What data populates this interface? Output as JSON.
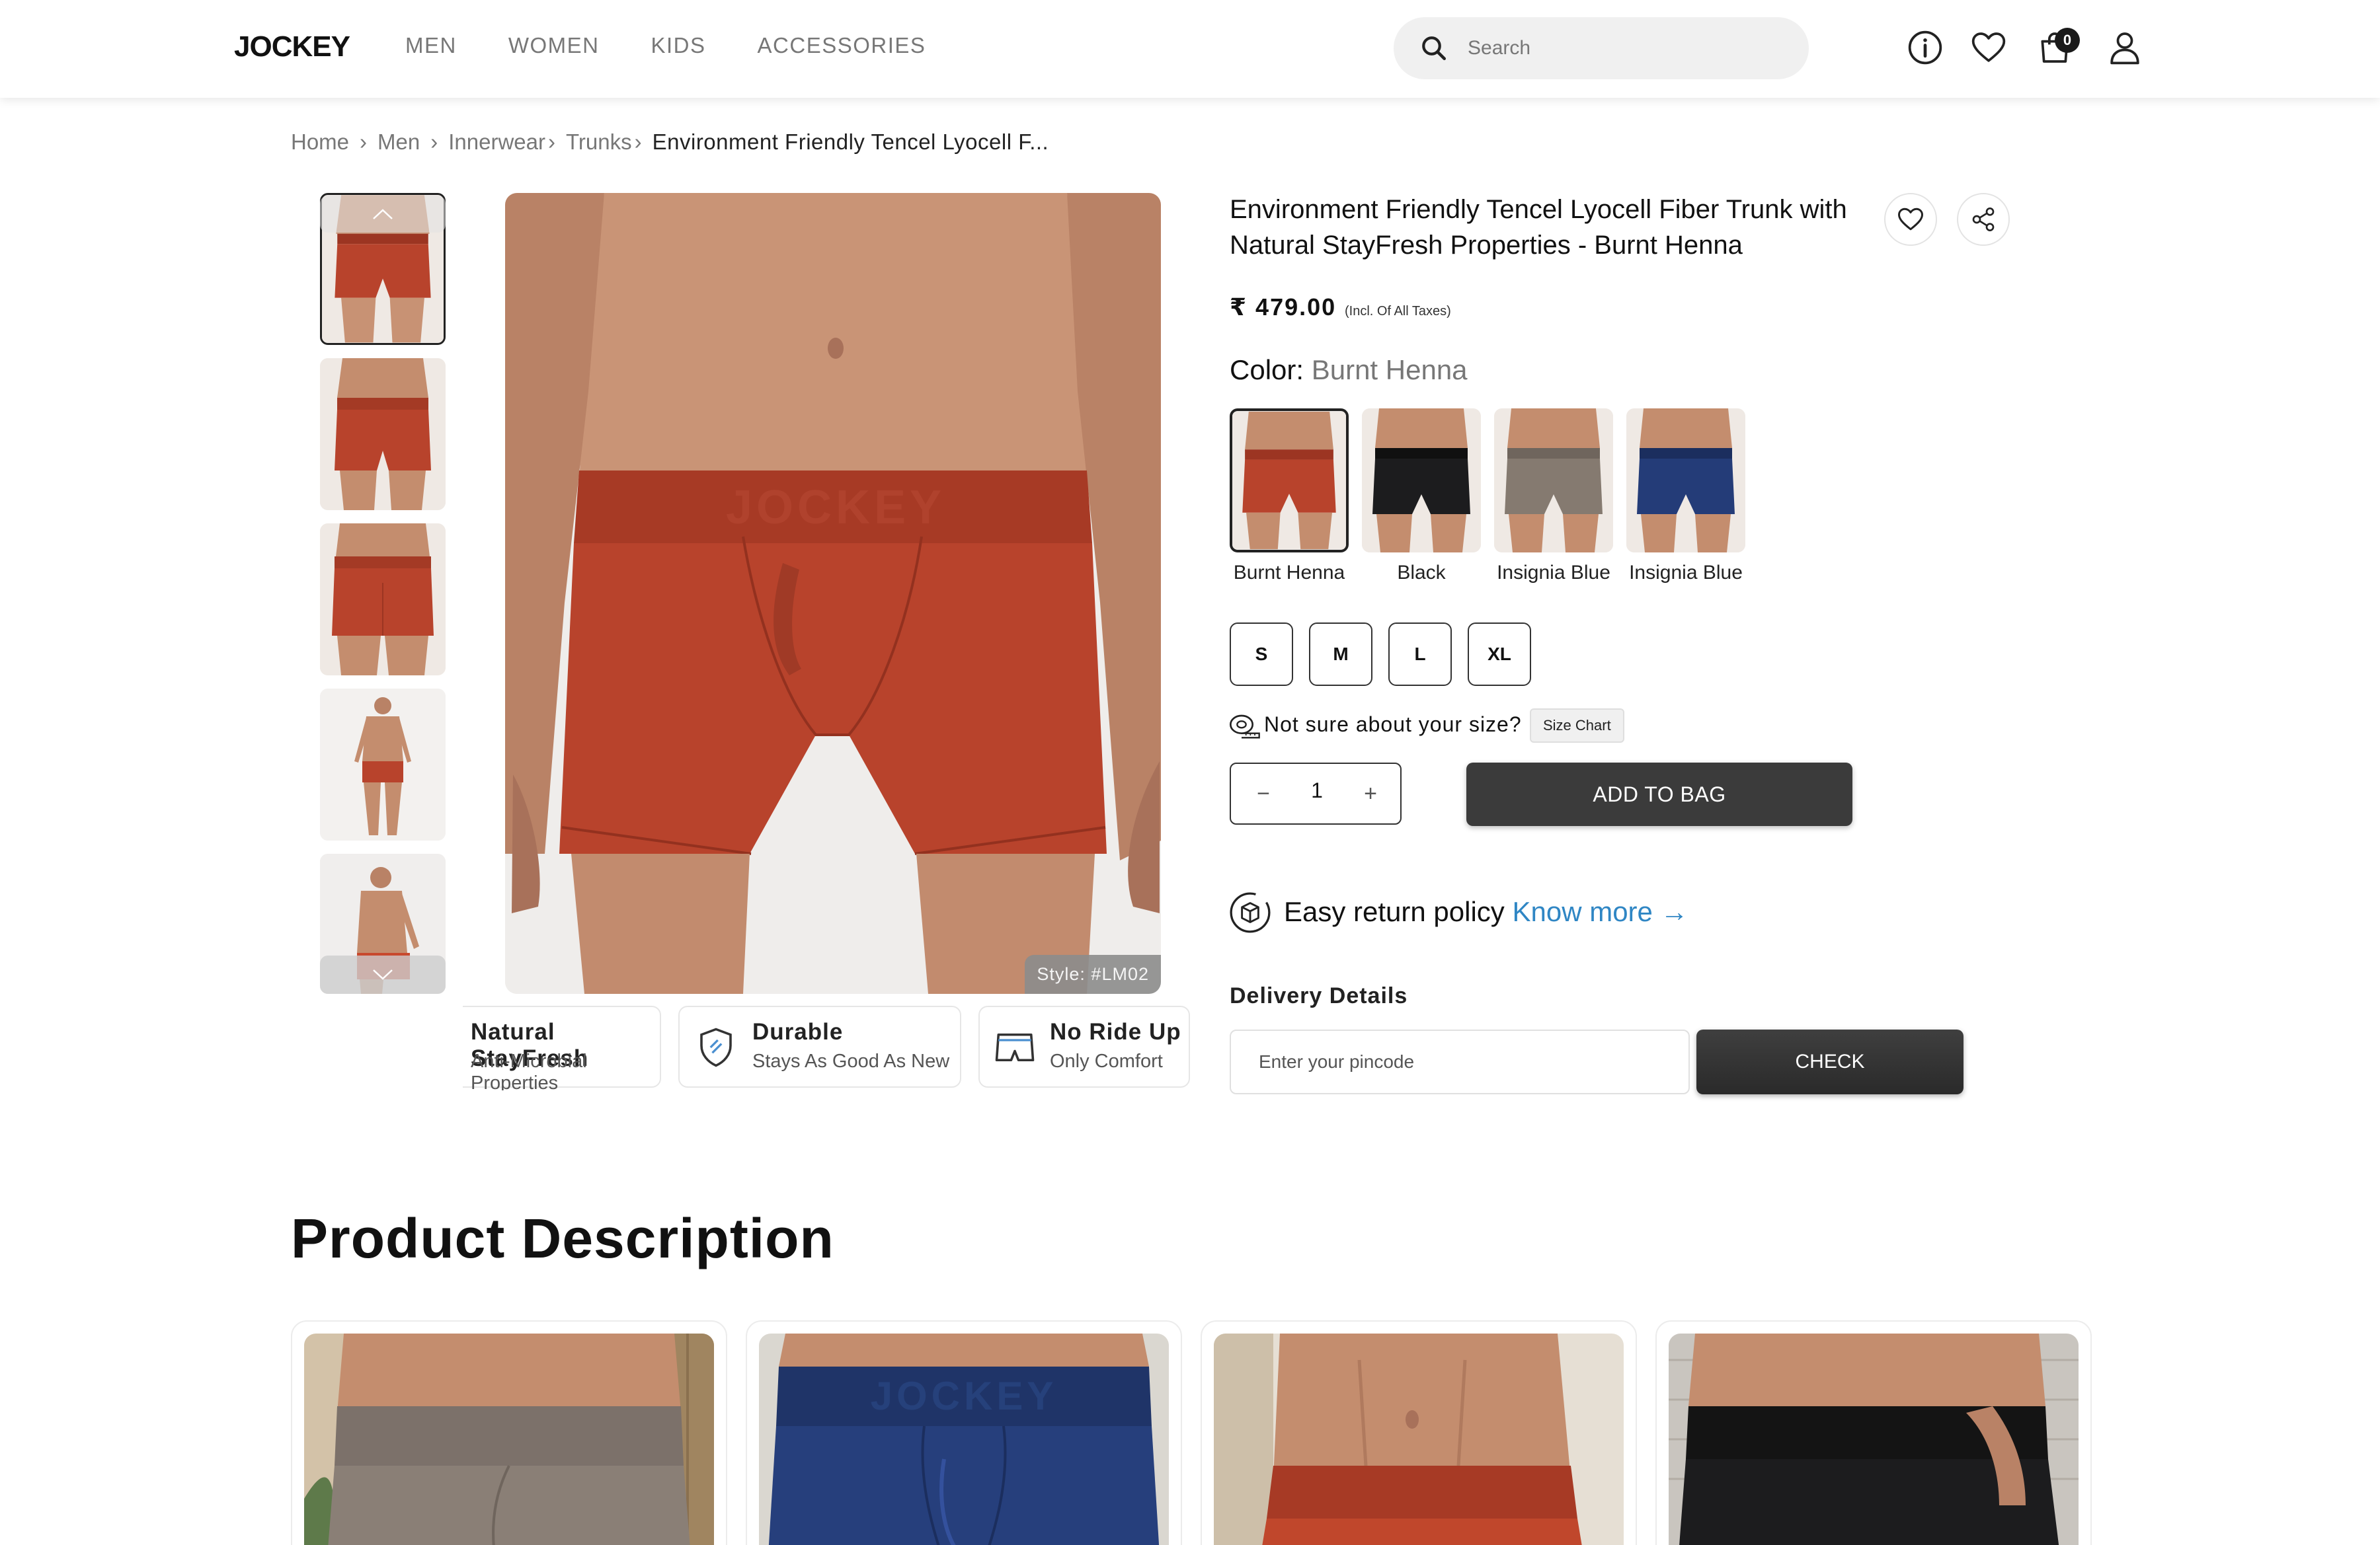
{
  "header": {
    "logo": "JOCKEY",
    "nav": [
      "MEN",
      "WOMEN",
      "KIDS",
      "ACCESSORIES"
    ],
    "search_placeholder": "Search",
    "cart_count": "0"
  },
  "breadcrumb": {
    "items": [
      "Home",
      "Men",
      "Innerwear",
      "Trunks"
    ],
    "separator": "›",
    "current": "Environment Friendly Tencel Lyocell F..."
  },
  "gallery": {
    "style_badge": "Style: #LM02"
  },
  "features": [
    {
      "title": "Natural StayFresh",
      "subtitle": "Anti-Microbial Properties"
    },
    {
      "title": "Durable",
      "subtitle": "Stays As Good As New"
    },
    {
      "title": "No Ride Up",
      "subtitle": "Only Comfort"
    }
  ],
  "product": {
    "title": "Environment Friendly Tencel Lyocell Fiber Trunk with Natural StayFresh Properties - Burnt Henna",
    "price": "₹ 479.00",
    "price_note": "(Incl. Of All Taxes)",
    "color_label": "Color:",
    "color_value": "Burnt Henna",
    "colors": [
      {
        "label": "Burnt Henna",
        "hex": "#b8432c",
        "selected": true
      },
      {
        "label": "Black",
        "hex": "#1c1c1e",
        "selected": false
      },
      {
        "label": "Insignia Blue",
        "hex": "#857a70",
        "selected": false
      },
      {
        "label": "Insignia Blue",
        "hex": "#243c78",
        "selected": false
      }
    ],
    "sizes": [
      "S",
      "M",
      "L",
      "XL"
    ],
    "size_hint": "Not sure about your size?",
    "size_chart": "Size Chart",
    "quantity": "1",
    "qty_minus": "−",
    "qty_plus": "+",
    "add_to_bag": "ADD TO BAG",
    "return_text": "Easy return policy",
    "return_link": "Know more →",
    "delivery_heading": "Delivery Details",
    "pincode_placeholder": "Enter your pincode",
    "check": "CHECK"
  },
  "description": {
    "heading": "Product Description",
    "cards": [
      {
        "color": "#8a7f76",
        "bg": "#c9b59a"
      },
      {
        "color": "#263f7c",
        "bg": "#d9d6cf"
      },
      {
        "color": "#c0472c",
        "bg": "#e8e2d8"
      },
      {
        "color": "#1c1c1e",
        "bg": "#c9c5bf"
      }
    ]
  },
  "colors": {
    "primary_button": "#3b3b3b",
    "link": "#2f86c4",
    "product": "#b8432c"
  }
}
